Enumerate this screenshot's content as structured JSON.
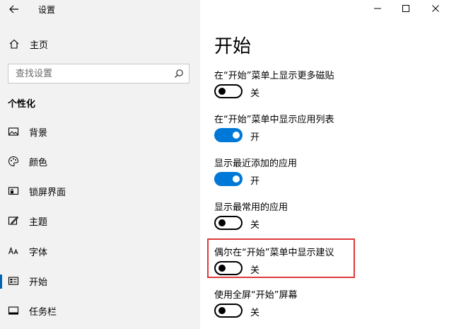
{
  "window": {
    "title": "设置"
  },
  "sidebar": {
    "home_label": "主页",
    "search_placeholder": "查找设置",
    "section_title": "个性化",
    "items": [
      {
        "label": "背景",
        "icon": "picture-icon"
      },
      {
        "label": "颜色",
        "icon": "palette-icon"
      },
      {
        "label": "锁屏界面",
        "icon": "lock-screen-icon"
      },
      {
        "label": "主题",
        "icon": "theme-brush-icon"
      },
      {
        "label": "字体",
        "icon": "font-icon"
      },
      {
        "label": "开始",
        "icon": "start-menu-icon",
        "active": true
      },
      {
        "label": "任务栏",
        "icon": "taskbar-icon"
      }
    ]
  },
  "main": {
    "title": "开始",
    "settings": [
      {
        "label": "在“开始”菜单上显示更多磁贴",
        "state": "关",
        "on": false
      },
      {
        "label": "在“开始”菜单中显示应用列表",
        "state": "开",
        "on": true
      },
      {
        "label": "显示最近添加的应用",
        "state": "开",
        "on": true
      },
      {
        "label": "显示最常用的应用",
        "state": "关",
        "on": false
      },
      {
        "label": "偶尔在“开始”菜单中显示建议",
        "state": "关",
        "on": false,
        "highlighted": true
      },
      {
        "label": "使用全屏“开始”屏幕",
        "state": "关",
        "on": false
      }
    ]
  },
  "colors": {
    "accent": "#0078d7",
    "highlight": "#e03a3a",
    "sidebar_bg": "#f2f2f2"
  }
}
